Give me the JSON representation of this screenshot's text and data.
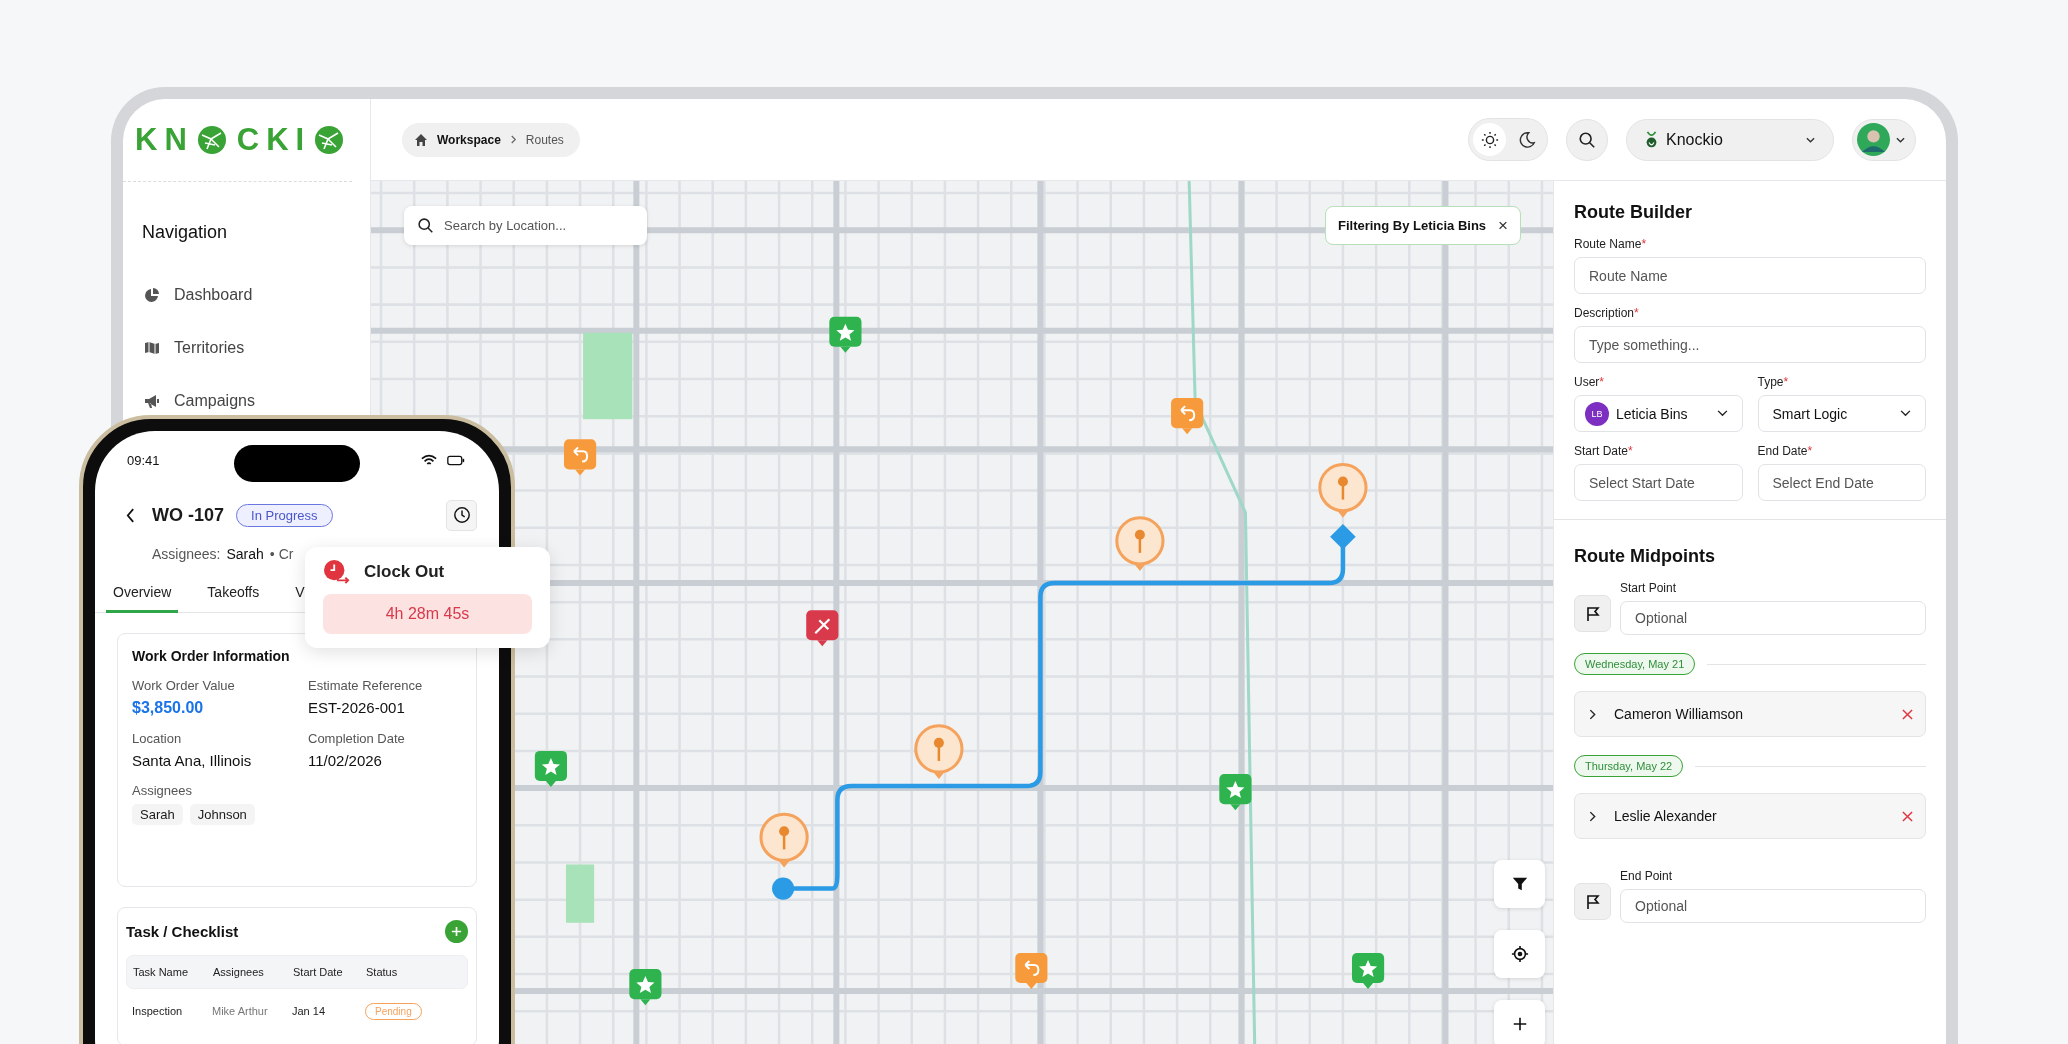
{
  "sidebar": {
    "logo": [
      "KN",
      "CKI"
    ],
    "section_title": "Navigation",
    "items": [
      {
        "label": "Dashboard",
        "selected": false
      },
      {
        "label": "Territories",
        "selected": false
      },
      {
        "label": "Campaigns",
        "selected": false
      }
    ]
  },
  "header": {
    "breadcrumb": [
      "Workspace",
      "Routes"
    ],
    "theme": [
      {
        "kind": "light",
        "selected": true
      },
      {
        "kind": "dark",
        "selected": false
      }
    ],
    "workspace": "Knockio"
  },
  "map": {
    "search": {
      "placeholder": "Search by Location..."
    },
    "filter_chip": {
      "label": "Filtering By Leticia Bins",
      "close": "×"
    }
  },
  "route_builder": {
    "title": "Route Builder",
    "rows": [
      [
        {
          "kind": "text",
          "label": "Route Name",
          "mark": "*",
          "placeholder": "Route Name"
        }
      ],
      [
        {
          "kind": "text",
          "label": "Description",
          "mark": "*",
          "placeholder": "Type something..."
        }
      ],
      [
        {
          "kind": "user_select",
          "label": "User",
          "mark": "*",
          "initials": "LB",
          "value": "Leticia Bins"
        },
        {
          "kind": "select",
          "label": "Type",
          "mark": "*",
          "value": "Smart Logic"
        }
      ],
      [
        {
          "kind": "text",
          "label": "Start Date",
          "mark": "*",
          "placeholder": "Select Start Date"
        },
        {
          "kind": "text",
          "label": "End Date",
          "mark": "*",
          "placeholder": "Select End Date"
        }
      ]
    ]
  },
  "midpoints": {
    "title": "Route Midpoints",
    "start": {
      "label": "Start Point",
      "placeholder": "Optional"
    },
    "days": [
      {
        "date": "Wednesday, May 21",
        "stops": [
          "Cameron Williamson"
        ]
      },
      {
        "date": "Thursday, May 22",
        "stops": [
          "Leslie Alexander"
        ]
      }
    ],
    "end": {
      "label": "End Point",
      "placeholder": "Optional"
    }
  },
  "phone": {
    "time": "09:41",
    "title": "WO -107",
    "status": "In Progress",
    "assignees_label": "Assignees:",
    "assignees_value": "Sarah",
    "meta_cut": "• Cr",
    "tabs": [
      {
        "label": "Overview",
        "selected": true
      },
      {
        "label": "Takeoffs",
        "selected": false
      },
      {
        "label": "V",
        "selected": false
      }
    ],
    "popover": {
      "title": "Clock Out",
      "timer": "4h 28m 45s"
    },
    "info": {
      "title": "Work Order Information",
      "fields": [
        {
          "label": "Work Order Value",
          "value": "$3,850.00",
          "kind": "amount"
        },
        {
          "label": "Estimate Reference",
          "value": "EST-2026-001",
          "kind": "plain"
        },
        {
          "label": "Location",
          "value": "Santa Ana, Illinois",
          "kind": "plain"
        },
        {
          "label": "Completion Date",
          "value": "11/02/2026",
          "kind": "plain"
        }
      ],
      "assignees_label": "Assignees",
      "assignees": [
        "Sarah",
        "Johnson"
      ]
    },
    "checklist": {
      "title": "Task / Checklist",
      "columns": [
        "Task Name",
        "Assignees",
        "Start Date",
        "Status"
      ],
      "rows": [
        {
          "cells": [
            "Inspection",
            "Mike Arthur",
            "Jan 14"
          ],
          "status": "Pending"
        }
      ]
    }
  }
}
